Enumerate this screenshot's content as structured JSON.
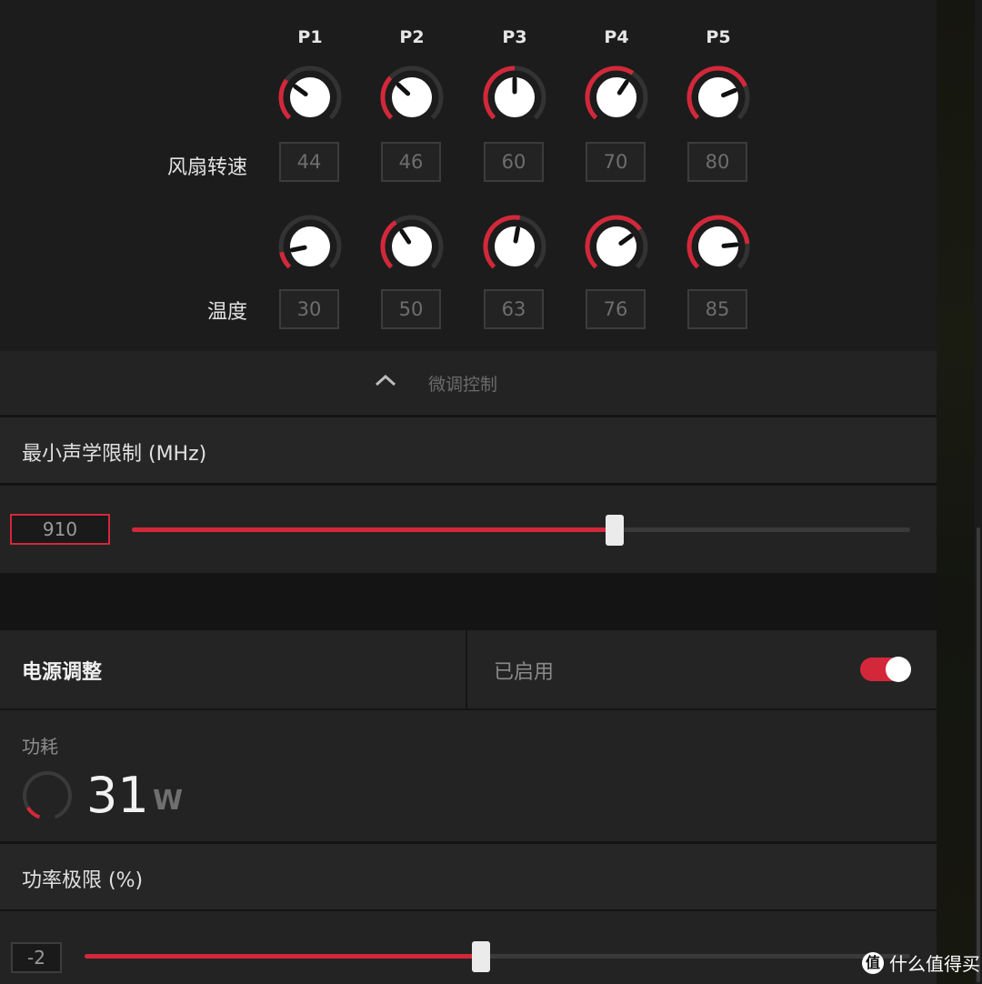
{
  "fan_curve": {
    "points": [
      "P1",
      "P2",
      "P3",
      "P4",
      "P5"
    ],
    "fan_speed_label": "风扇转速",
    "fan_speed_values": [
      "44",
      "46",
      "60",
      "70",
      "80"
    ],
    "temperature_label": "温度",
    "temperature_values": [
      "30",
      "50",
      "63",
      "76",
      "85"
    ]
  },
  "fine_tune": {
    "label": "微调控制"
  },
  "min_acoustic": {
    "title": "最小声学限制 (MHz)",
    "value": "910",
    "slider_fraction": 0.62
  },
  "power_tuning": {
    "title": "电源调整",
    "status_label": "已启用",
    "enabled": true
  },
  "power_consumption": {
    "label": "功耗",
    "value": "31",
    "unit": "W",
    "gauge_fraction": 0.12
  },
  "power_limit": {
    "title": "功率极限 (%)",
    "value": "-2",
    "slider_fraction": 0.48
  },
  "watermark": {
    "icon_text": "值",
    "text": "什么值得买"
  },
  "colors": {
    "accent": "#d3283a",
    "panel": "#1c1c1c",
    "row": "#232323"
  }
}
